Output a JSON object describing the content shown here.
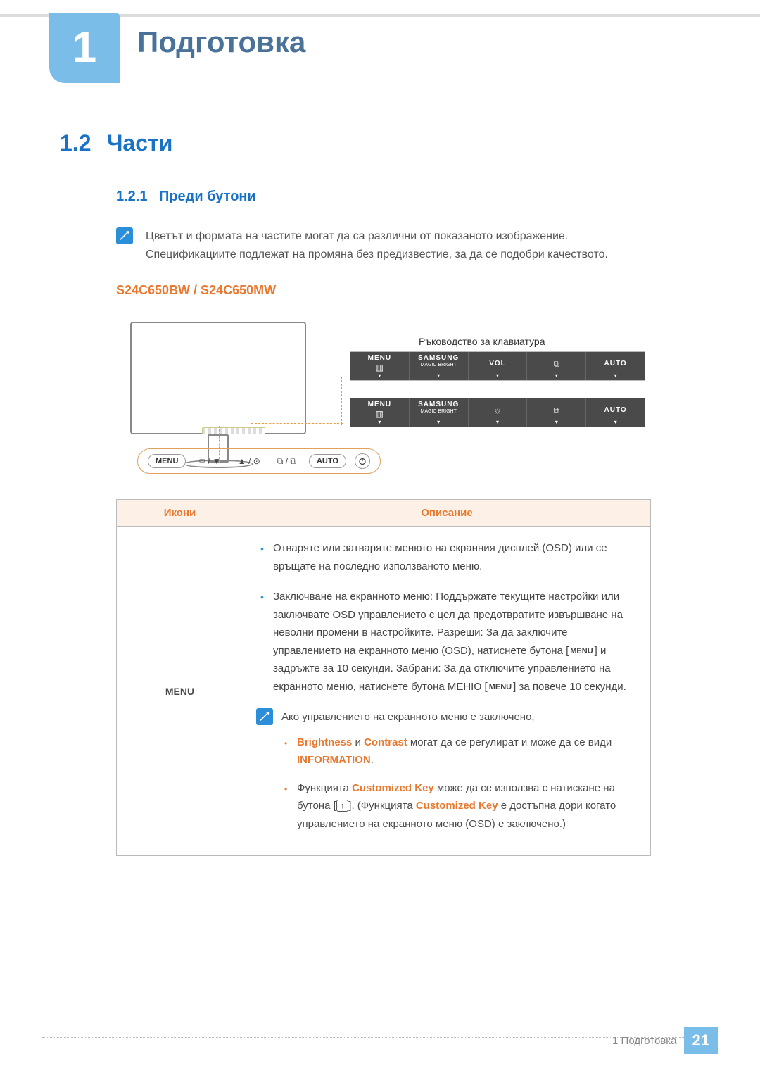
{
  "chapter": {
    "number": "1",
    "title": "Подготовка"
  },
  "section": {
    "number": "1.2",
    "title": "Части"
  },
  "subsection": {
    "number": "1.2.1",
    "title": "Преди бутони"
  },
  "note": {
    "line1": "Цветът и формата на частите могат да са различни от показаното изображение.",
    "line2": "Спецификациите подлежат на промяна без предизвестие, за да се подобри качеството."
  },
  "model_heading": "S24C650BW / S24C650MW",
  "diagram": {
    "keyboard_title": "Ръководство за клавиатура",
    "panel1": {
      "cells": [
        {
          "top": "MENU",
          "sub": "",
          "icon": "▥"
        },
        {
          "top": "SAMSUNG",
          "sub": "MAGIC\nBRIGHT",
          "icon": ""
        },
        {
          "top": "VOL",
          "sub": "",
          "icon": ""
        },
        {
          "top": "",
          "sub": "",
          "icon": "⧉"
        },
        {
          "top": "AUTO",
          "sub": "",
          "icon": ""
        }
      ]
    },
    "panel2": {
      "cells": [
        {
          "top": "MENU",
          "sub": "",
          "icon": "▥"
        },
        {
          "top": "SAMSUNG",
          "sub": "MAGIC\nBRIGHT",
          "icon": ""
        },
        {
          "top": "",
          "sub": "",
          "icon": "☼"
        },
        {
          "top": "",
          "sub": "",
          "icon": "⧉"
        },
        {
          "top": "AUTO",
          "sub": "",
          "icon": ""
        }
      ]
    },
    "buttons": {
      "b0": "MENU",
      "b1": "⮹ / ▼",
      "b2": "▲ / ⊙",
      "b3": "⧉ / ⧉",
      "b4": "AUTO"
    }
  },
  "table": {
    "header_icons": "Икони",
    "header_desc": "Описание",
    "row1": {
      "icon_label": "MENU",
      "bullet1": "Отваряте или затваряте менюто на екранния дисплей (OSD) или се връщате на последно използваното меню.",
      "bullet2_a": "Заключване на екранното меню: Поддържате текущите настройки или заключвате OSD управлението с цел да предотвратите извършване на неволни промени в настройките. Разреши: За да заключите управлението на екранното меню (OSD), натиснете бутона [",
      "bullet2_b": "] и задръжте за 10 секунди. Забрани: За да отключите управлението на екранното меню, натиснете бутона МЕНЮ [",
      "bullet2_c": "] за повече 10 секунди.",
      "note_intro": "Ако управлението на екранното меню е заключено,",
      "sub1_a": "Brightness",
      "sub1_b": " и ",
      "sub1_c": "Contrast",
      "sub1_d": " могат да се регулират и може да се види ",
      "sub1_e": "INFORMATION",
      "sub1_f": ".",
      "sub2_a": "Функцията ",
      "sub2_b": "Customized Key",
      "sub2_c": " може да се използва с натискане на бутона [",
      "sub2_d": "]. (Функцията ",
      "sub2_e": "Customized Key",
      "sub2_f": " е достъпна дори когато управлението на екранното меню (OSD) е заключено.)"
    }
  },
  "footer": {
    "text": "1 Подготовка",
    "page": "21"
  }
}
